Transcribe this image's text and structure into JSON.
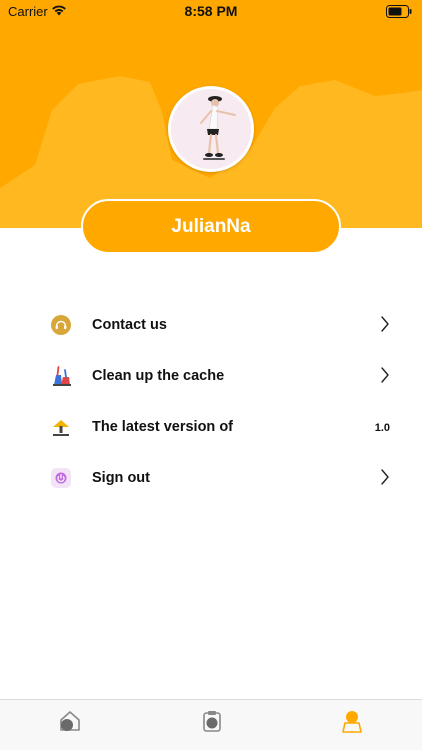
{
  "status_bar": {
    "carrier": "Carrier",
    "time": "8:58 PM"
  },
  "profile": {
    "username": "JulianNa"
  },
  "menu": {
    "items": [
      {
        "label": "Contact us",
        "icon": "headset-icon"
      },
      {
        "label": "Clean up the cache",
        "icon": "broom-icon"
      },
      {
        "label": "The latest version of",
        "icon": "upload-icon",
        "value": "1.0"
      },
      {
        "label": "Sign out",
        "icon": "power-icon"
      }
    ]
  },
  "tabbar": {
    "tabs": [
      "home-tab",
      "clipboard-tab",
      "profile-tab"
    ]
  },
  "colors": {
    "accent": "#FFA800",
    "accent_light": "#FFB81F",
    "white": "#ffffff"
  }
}
